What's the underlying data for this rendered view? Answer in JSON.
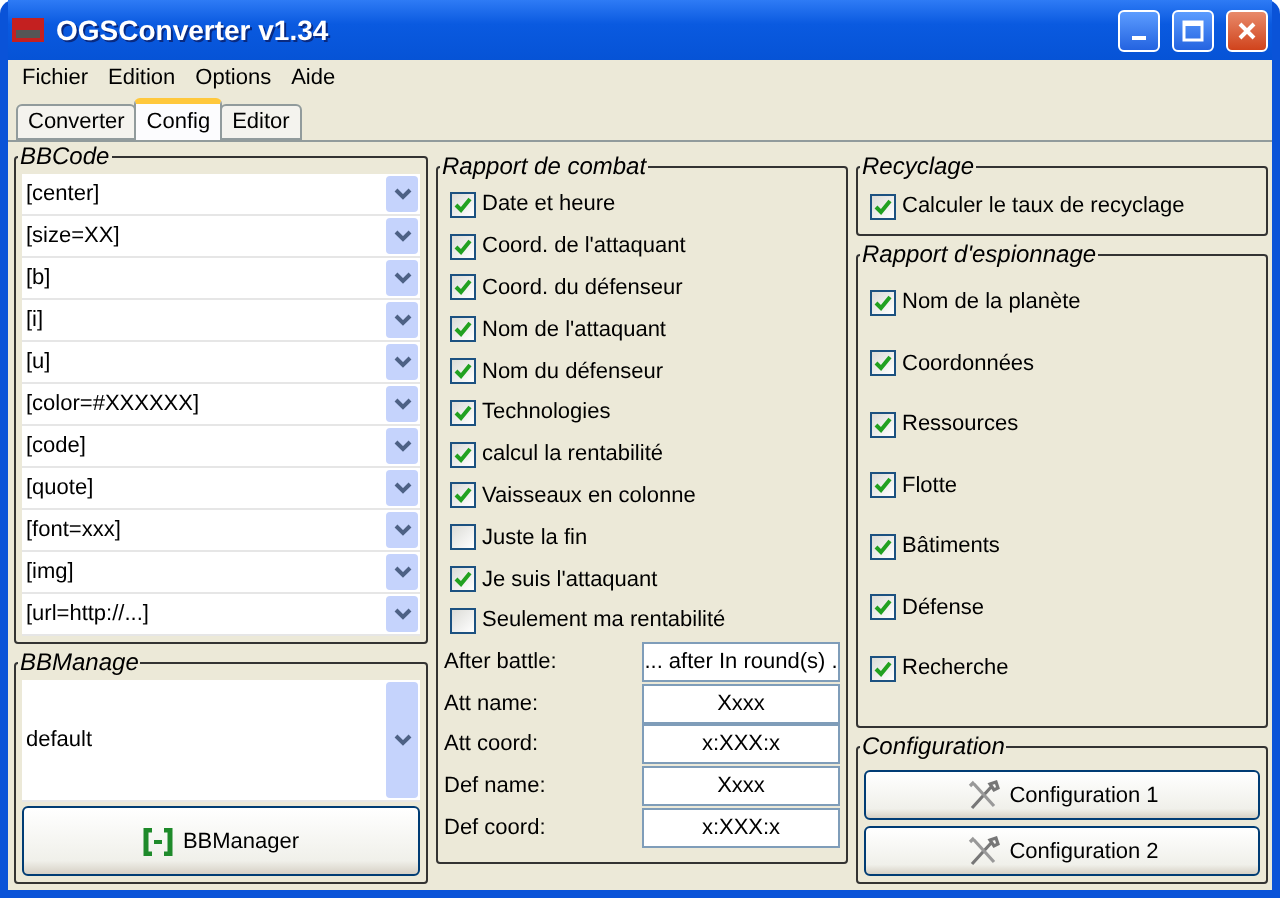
{
  "window": {
    "title": "OGSConverter v1.34"
  },
  "menu": [
    "Fichier",
    "Edition",
    "Options",
    "Aide"
  ],
  "tabs": [
    {
      "label": "Converter",
      "selected": false
    },
    {
      "label": "Config",
      "selected": true
    },
    {
      "label": "Editor",
      "selected": false
    }
  ],
  "bbcode": {
    "title": "BBCode",
    "items": [
      "[center]",
      "[size=XX]",
      "[b]",
      "[i]",
      "[u]",
      "[color=#XXXXXX]",
      "[code]",
      "[quote]",
      "[font=xxx]",
      "[img]",
      "[url=http://...]"
    ]
  },
  "bbmanage": {
    "title": "BBManage",
    "value": "default",
    "button": "BBManager"
  },
  "combat": {
    "title": "Rapport de combat",
    "options": [
      {
        "label": "Date et heure",
        "checked": true
      },
      {
        "label": "Coord. de l'attaquant",
        "checked": true
      },
      {
        "label": "Coord. du défenseur",
        "checked": true
      },
      {
        "label": "Nom de l'attaquant",
        "checked": true
      },
      {
        "label": "Nom du défenseur",
        "checked": true
      },
      {
        "label": "Technologies",
        "checked": true
      },
      {
        "label": "calcul la rentabilité",
        "checked": true
      },
      {
        "label": "Vaisseaux en colonne",
        "checked": true
      },
      {
        "label": "Juste la fin",
        "checked": false
      },
      {
        "label": "Je suis l'attaquant",
        "checked": true
      },
      {
        "label": "Seulement ma rentabilité",
        "checked": false
      }
    ],
    "fields": [
      {
        "label": "After battle:",
        "value": "... after In round(s) ."
      },
      {
        "label": "Att name:",
        "value": "Xxxx"
      },
      {
        "label": "Att coord:",
        "value": "x:XXX:x"
      },
      {
        "label": "Def name:",
        "value": "Xxxx"
      },
      {
        "label": "Def coord:",
        "value": "x:XXX:x"
      }
    ]
  },
  "recyclage": {
    "title": "Recyclage",
    "options": [
      {
        "label": "Calculer le taux de recyclage",
        "checked": true
      }
    ]
  },
  "espionnage": {
    "title": "Rapport d'espionnage",
    "options": [
      {
        "label": "Nom de la planète",
        "checked": true
      },
      {
        "label": "Coordonnées",
        "checked": true
      },
      {
        "label": "Ressources",
        "checked": true
      },
      {
        "label": "Flotte",
        "checked": true
      },
      {
        "label": "Bâtiments",
        "checked": true
      },
      {
        "label": "Défense",
        "checked": true
      },
      {
        "label": "Recherche",
        "checked": true
      }
    ]
  },
  "configuration": {
    "title": "Configuration",
    "buttons": [
      "Configuration 1",
      "Configuration 2"
    ]
  }
}
